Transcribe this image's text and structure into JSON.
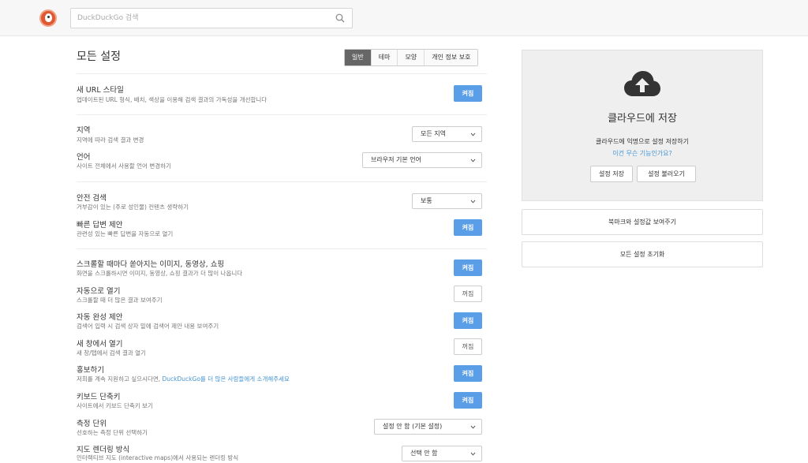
{
  "search": {
    "placeholder": "DuckDuckGo 검색"
  },
  "page_title": "모든 설정",
  "tabs": [
    {
      "label": "일반",
      "active": true
    },
    {
      "label": "테마"
    },
    {
      "label": "모양"
    },
    {
      "label": "개인 정보 보호"
    }
  ],
  "settings": {
    "url_style": {
      "title": "새 URL 스타일",
      "desc": "업데이트된 URL 형식, 배치, 색상을 이용해 검색 결과의 가독성을 개선합니다",
      "toggle": "켜짐"
    },
    "region": {
      "title": "지역",
      "desc": "지역에 따라 검색 결과 변경",
      "select": "모든 지역"
    },
    "language": {
      "title": "언어",
      "desc": "사이트 전체에서 사용할 언어 변경하기",
      "select": "브라우저 기본 언어"
    },
    "safe_search": {
      "title": "안전 검색",
      "desc": "거부감이 있는 (주로 성인물) 컨텐츠 생략하기",
      "select": "보통"
    },
    "instant_answers": {
      "title": "빠른 답변 제안",
      "desc": "관련성 있는 빠른 답변을 자동으로 열기",
      "toggle": "켜짐"
    },
    "infinite_scroll_media": {
      "title": "스크롤할 때마다 쏟아지는 이미지, 동영상, 쇼핑",
      "desc": "화면을 스크롤하시면 이미지, 동영상, 쇼핑 결과가 더 많이 나옵니다",
      "toggle": "켜짐"
    },
    "auto_load": {
      "title": "자동으로 열기",
      "desc": "스크롤할 때 더 많은 결과 보여주기",
      "toggle": "꺼짐"
    },
    "autosuggest": {
      "title": "자동 완성 제안",
      "desc": "검색어 입력 시 검색 상자 밑에 검색어 제안 내용 보여주기",
      "toggle": "켜짐"
    },
    "new_window": {
      "title": "새 창에서 열기",
      "desc": "새 창/탭에서 검색 결과 열기",
      "toggle": "꺼짐"
    },
    "promotion": {
      "title": "홍보하기",
      "desc_prefix": "저희를 계속 지원하고 싶으시다면, ",
      "desc_link": "DuckDuckGo를 더 많은 사람들에게 소개해주세요",
      "toggle": "켜짐"
    },
    "keyboard": {
      "title": "키보드 단축키",
      "desc": "사이트에서 키보드 단축키 보기",
      "toggle": "켜짐"
    },
    "units": {
      "title": "측정 단위",
      "desc": "선호하는 측정 단위 선택하기",
      "select": "설정 안 함 (기본 설정)"
    },
    "maps": {
      "title": "지도 렌더링 방식",
      "desc": "인터랙티브 지도 (interactive maps)에서 사용되는 렌더링 방식",
      "select": "선택 안 함"
    }
  },
  "cloud": {
    "icon": "cloud-upload-icon",
    "title": "클라우드에 저장",
    "desc": "클라우드에 익명으로 설정 저장하기",
    "link": "이건 무슨 기능인가요?",
    "save_label": "설정 저장",
    "load_label": "설정 불러오기"
  },
  "bookmark_button": "북마크와 설정값 보여주기",
  "reset_button": "모든 설정 초기화",
  "colors": {
    "accent": "#5b9ee8",
    "brand": "#de5833",
    "link": "#4495d4"
  }
}
